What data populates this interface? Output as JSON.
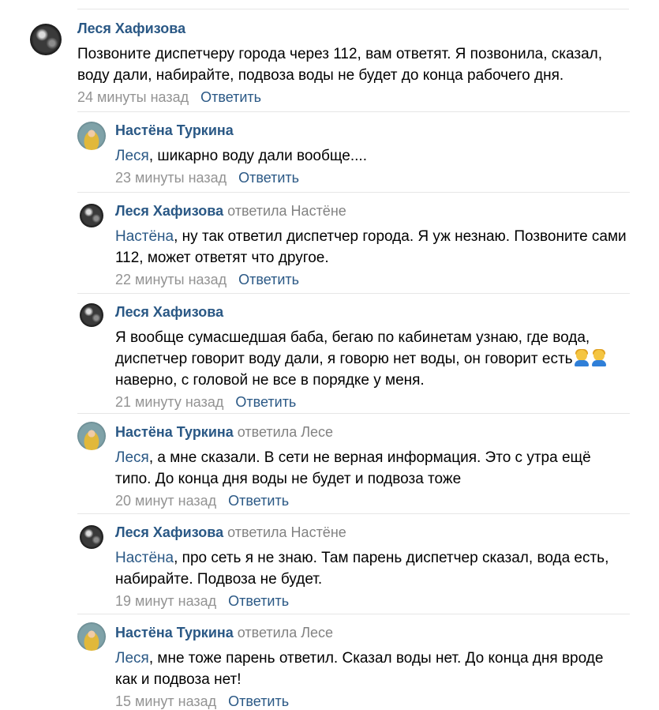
{
  "reply_label": "Ответить",
  "emojis": [
    "person-emoji"
  ],
  "comments": [
    {
      "author": "Леся Хафизова",
      "reply_note": "",
      "mention": "",
      "text": "Позвоните диспетчеру города через 112, вам ответят. Я позвонила, сказал, воду дали, набирайте, подвоза воды не будет до конца рабочего дня.",
      "time": "24 минуты назад"
    },
    {
      "author": "Настёна Туркина",
      "reply_note": "",
      "mention": "Леся",
      "text": ", шикарно воду дали вообще....",
      "time": "23 минуты назад"
    },
    {
      "author": "Леся Хафизова",
      "reply_note": "ответила Настёне",
      "mention": "Настёна",
      "text": ", ну так ответил диспетчер города. Я уж незнаю. Позвоните сами 112, может ответят что другое.",
      "time": "22 минуты назад"
    },
    {
      "author": "Леся Хафизова",
      "reply_note": "",
      "mention": "",
      "text_before": "Я вообще сумасшедшая баба, бегаю по кабинетам узнаю, где вода, диспетчер говорит воду дали, я говорю нет воды, он говорит есть",
      "text_after": " наверно, с головой не все в порядке у меня.",
      "time": "21 минуту назад"
    },
    {
      "author": "Настёна Туркина",
      "reply_note": "ответила Лесе",
      "mention": "Леся",
      "text": ", а мне сказали. В сети не верная информация. Это с утра ещё типо. До конца дня воды не будет и подвоза тоже",
      "time": "20 минут назад"
    },
    {
      "author": "Леся Хафизова",
      "reply_note": "ответила Настёне",
      "mention": "Настёна",
      "text": ", про сеть я не знаю. Там парень диспетчер сказал, вода есть, набирайте. Подвоза не будет.",
      "time": "19 минут назад"
    },
    {
      "author": "Настёна Туркина",
      "reply_note": "ответила Лесе",
      "mention": "Леся",
      "text": ", мне тоже парень ответил. Сказал воды нет. До конца дня вроде как и подвоза нет!",
      "time": "15 минут назад"
    }
  ]
}
